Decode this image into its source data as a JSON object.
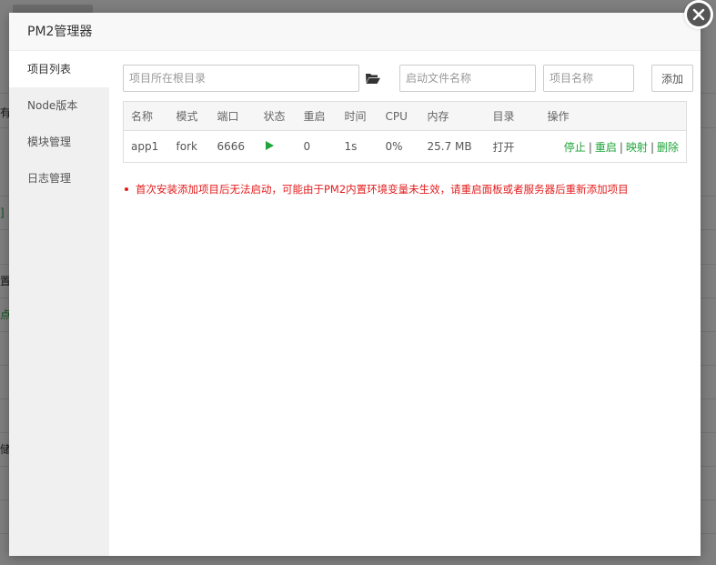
{
  "dialog": {
    "title": "PM2管理器"
  },
  "sidebar": {
    "items": [
      {
        "label": "项目列表",
        "active": true
      },
      {
        "label": "Node版本",
        "active": false
      },
      {
        "label": "模块管理",
        "active": false
      },
      {
        "label": "日志管理",
        "active": false
      }
    ]
  },
  "toolbar": {
    "project_dir_placeholder": "项目所在根目录",
    "folder_icon": "folder-open-icon",
    "start_file_placeholder": "启动文件名称",
    "project_name_placeholder": "项目名称",
    "add_label": "添加"
  },
  "table": {
    "headers": {
      "name": "名称",
      "mode": "模式",
      "port": "端口",
      "status": "状态",
      "restart": "重启",
      "time": "时间",
      "cpu": "CPU",
      "memory": "内存",
      "dir": "目录",
      "ops": "操作"
    },
    "rows": [
      {
        "name": "app1",
        "mode": "fork",
        "port": "6666",
        "status_icon": "play-icon",
        "restart": "0",
        "time": "1s",
        "cpu": "0%",
        "memory": "25.7 MB",
        "dir": "打开",
        "ops": {
          "stop": "停止",
          "restart": "重启",
          "map": "映射",
          "delete": "删除"
        }
      }
    ]
  },
  "notice": "首次安装添加项目后无法启动，可能由于PM2内置环境变量未生效，请重启面板或者服务器后重新添加项目",
  "background": {
    "texts": [
      "有",
      "]",
      "置",
      "点",
      "储"
    ]
  },
  "colors": {
    "accent_green": "#20a53a",
    "notice_red": "#e31c1c",
    "close_button": "#555555"
  }
}
